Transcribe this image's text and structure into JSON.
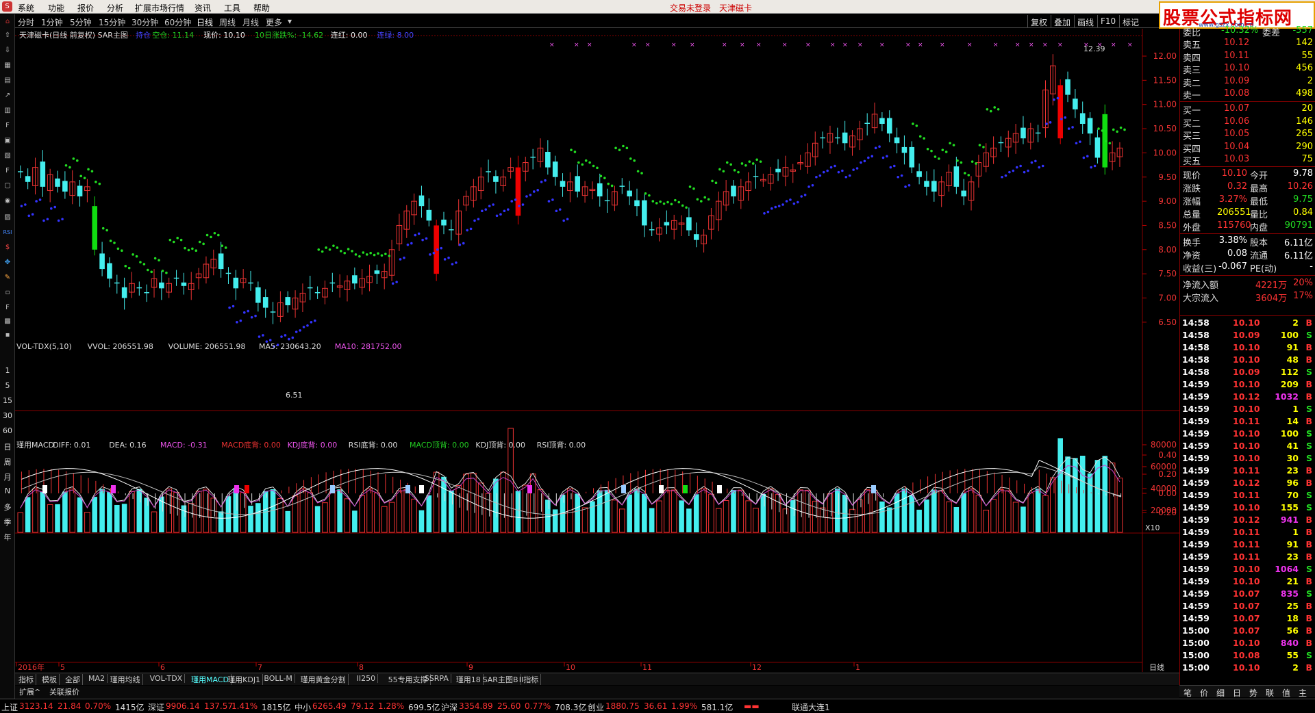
{
  "menu": {
    "items": [
      "系统",
      "功能",
      "报价",
      "分析",
      "扩展市场行情",
      "资讯",
      "工具",
      "帮助"
    ],
    "center_left": "交易未登录",
    "center_right": "天津磁卡"
  },
  "brand": {
    "title": "股票公式指标网",
    "sub": "www.gszx.com.cn"
  },
  "periods": [
    "分时",
    "1分钟",
    "5分钟",
    "15分钟",
    "30分钟",
    "60分钟",
    "日线",
    "周线",
    "月线",
    "更多"
  ],
  "active_period": "日线",
  "right_buttons": [
    "复权",
    "叠加",
    "画线",
    "F10",
    "标记"
  ],
  "left_tools": [
    "S",
    "F1",
    "F2",
    "F3",
    "F4",
    "F5",
    "F6",
    "F7",
    "F8",
    "F9",
    "F10",
    "RSI",
    "$",
    "F5",
    "F6",
    "F7"
  ],
  "left_numbers": [
    "1",
    "5",
    "15",
    "30",
    "60",
    "日",
    "周",
    "月",
    "N",
    "多",
    "季",
    "年"
  ],
  "main_header": {
    "stock": "天津磁卡(日线 前复权) SAR主图",
    "items": [
      {
        "t": "持仓",
        "c": "#44f"
      },
      {
        "t": "空仓: 11.14",
        "c": "#2c2"
      },
      {
        "t": "现价: 10.10",
        "c": "#eee"
      },
      {
        "t": "10日涨跌%: -14.62",
        "c": "#2c2"
      },
      {
        "t": "连红: 0.00",
        "c": "#eee"
      },
      {
        "t": "连绿: 8.00",
        "c": "#44f"
      }
    ]
  },
  "vol_header": {
    "items": [
      {
        "t": "VOL-TDX(5,10)",
        "c": "#ddd"
      },
      {
        "t": "VVOL: 206551.98",
        "c": "#ddd"
      },
      {
        "t": "VOLUME: 206551.98",
        "c": "#ddd"
      },
      {
        "t": "MA5: 230643.20",
        "c": "#ddd"
      },
      {
        "t": "MA10: 281752.00",
        "c": "#e5e"
      }
    ]
  },
  "macd_header": {
    "items": [
      {
        "t": "瑾用MACD",
        "c": "#ddd"
      },
      {
        "t": "DIFF: 0.01",
        "c": "#ddd"
      },
      {
        "t": "DEA: 0.16",
        "c": "#ddd"
      },
      {
        "t": "MACD: -0.31",
        "c": "#e5e"
      },
      {
        "t": "MACD底背: 0.00",
        "c": "#e33"
      },
      {
        "t": "KDJ底背: 0.00",
        "c": "#e5e"
      },
      {
        "t": "RSI底背: 0.00",
        "c": "#ddd"
      },
      {
        "t": "MACD顶背: 0.00",
        "c": "#2c2"
      },
      {
        "t": "KDJ顶背: 0.00",
        "c": "#ddd"
      },
      {
        "t": "RSI顶背: 0.00",
        "c": "#ddd"
      }
    ]
  },
  "price_axis": [
    "12.00",
    "11.50",
    "11.00",
    "10.50",
    "10.00",
    "9.50",
    "9.00",
    "8.50",
    "8.00",
    "7.50",
    "7.00",
    "6.50"
  ],
  "vol_axis": [
    "80000",
    "60000",
    "40000",
    "20000"
  ],
  "vol_unit": "X10",
  "macd_axis": [
    "0.40",
    "0.20",
    "0.00",
    "-0.20"
  ],
  "date_labels": [
    "2016年",
    "5",
    "6",
    "7",
    "8",
    "9",
    "10",
    "11",
    "12",
    "1"
  ],
  "date_right": "日线",
  "annotations": {
    "low": "6.51",
    "high": "12.39"
  },
  "chart_data": {
    "type": "candlestick",
    "title": "天津磁卡(日线 前复权) SAR主图",
    "high": 12.39,
    "low": 6.51,
    "last_close": 10.1,
    "ylim": [
      6.3,
      12.6
    ],
    "x_labels": [
      "2016年",
      "5",
      "6",
      "7",
      "8",
      "9",
      "10",
      "11",
      "12",
      "1"
    ]
  },
  "quote": {
    "top_partial": {
      "label": "委比",
      "value": "-10.32%",
      "label2": "委差",
      "value2": "-557"
    },
    "asks": [
      {
        "l": "卖五",
        "p": "10.12",
        "v": "142"
      },
      {
        "l": "卖四",
        "p": "10.11",
        "v": "55"
      },
      {
        "l": "卖三",
        "p": "10.10",
        "v": "456"
      },
      {
        "l": "卖二",
        "p": "10.09",
        "v": "2"
      },
      {
        "l": "卖一",
        "p": "10.08",
        "v": "498"
      }
    ],
    "bids": [
      {
        "l": "买一",
        "p": "10.07",
        "v": "20"
      },
      {
        "l": "买二",
        "p": "10.06",
        "v": "146"
      },
      {
        "l": "买三",
        "p": "10.05",
        "v": "265"
      },
      {
        "l": "买四",
        "p": "10.04",
        "v": "290"
      },
      {
        "l": "买五",
        "p": "10.03",
        "v": "75"
      }
    ],
    "stats": [
      {
        "l1": "现价",
        "v1": "10.10",
        "c1": "#f33",
        "l2": "今开",
        "v2": "9.78",
        "c2": "#fff"
      },
      {
        "l1": "涨跌",
        "v1": "0.32",
        "c1": "#f33",
        "l2": "最高",
        "v2": "10.26",
        "c2": "#f33"
      },
      {
        "l1": "涨幅",
        "v1": "3.27%",
        "c1": "#f33",
        "l2": "最低",
        "v2": "9.75",
        "c2": "#2d2"
      },
      {
        "l1": "总量",
        "v1": "206551",
        "c1": "#ff0",
        "l2": "量比",
        "v2": "0.84",
        "c2": "#ff0"
      },
      {
        "l1": "外盘",
        "v1": "115760",
        "c1": "#f33",
        "l2": "内盘",
        "v2": "90791",
        "c2": "#2d2"
      }
    ],
    "fund": [
      {
        "l1": "换手",
        "v1": "3.38%",
        "l2": "股本",
        "v2": "6.11亿"
      },
      {
        "l1": "净资",
        "v1": "0.08",
        "l2": "流通",
        "v2": "6.11亿"
      },
      {
        "l1": "收益(三)",
        "v1": "-0.067",
        "l2": "PE(动)",
        "v2": "-"
      }
    ],
    "flow": [
      {
        "l": "净流入额",
        "v": "4221万",
        "p": "20%"
      },
      {
        "l": "大宗流入",
        "v": "3604万",
        "p": "17%"
      }
    ]
  },
  "ticks": [
    [
      "14:58",
      "10.10",
      "2",
      "B"
    ],
    [
      "14:58",
      "10.09",
      "100",
      "S"
    ],
    [
      "14:58",
      "10.10",
      "91",
      "B"
    ],
    [
      "14:58",
      "10.10",
      "48",
      "B"
    ],
    [
      "14:58",
      "10.09",
      "112",
      "S"
    ],
    [
      "14:59",
      "10.10",
      "209",
      "B"
    ],
    [
      "14:59",
      "10.12",
      "1032",
      "B"
    ],
    [
      "14:59",
      "10.10",
      "1",
      "S"
    ],
    [
      "14:59",
      "10.11",
      "14",
      "B"
    ],
    [
      "14:59",
      "10.10",
      "100",
      "S"
    ],
    [
      "14:59",
      "10.10",
      "41",
      "S"
    ],
    [
      "14:59",
      "10.10",
      "30",
      "S"
    ],
    [
      "14:59",
      "10.11",
      "23",
      "B"
    ],
    [
      "14:59",
      "10.12",
      "96",
      "B"
    ],
    [
      "14:59",
      "10.11",
      "70",
      "S"
    ],
    [
      "14:59",
      "10.10",
      "155",
      "S"
    ],
    [
      "14:59",
      "10.12",
      "941",
      "B"
    ],
    [
      "14:59",
      "10.11",
      "1",
      "B"
    ],
    [
      "14:59",
      "10.11",
      "91",
      "B"
    ],
    [
      "14:59",
      "10.11",
      "23",
      "B"
    ],
    [
      "14:59",
      "10.10",
      "1064",
      "S"
    ],
    [
      "14:59",
      "10.10",
      "21",
      "B"
    ],
    [
      "14:59",
      "10.07",
      "835",
      "S"
    ],
    [
      "14:59",
      "10.07",
      "25",
      "B"
    ],
    [
      "14:59",
      "10.07",
      "18",
      "B"
    ],
    [
      "15:00",
      "10.07",
      "56",
      "B"
    ],
    [
      "15:00",
      "10.10",
      "840",
      "B"
    ],
    [
      "15:00",
      "10.08",
      "55",
      "S"
    ],
    [
      "15:00",
      "10.10",
      "2",
      "B"
    ]
  ],
  "tabs": [
    "指标",
    "模板",
    "全部",
    "MA2",
    "瑾用均线",
    "VOL-TDX",
    "瑾用MACD",
    "瑾用KDJ1",
    "BOLL-M",
    "瑾用黄金分割",
    "II250",
    "55专用支撑",
    "SSRPA",
    "瑾用18",
    "SAR主图B",
    "II指标"
  ],
  "active_tab": "瑾用MACD",
  "tabs2": [
    "扩展^",
    "关联报价"
  ],
  "right_tabs": [
    "笔",
    "价",
    "细",
    "日",
    "势",
    "联",
    "值",
    "主"
  ],
  "status": [
    {
      "name": "上证",
      "val": "3123.14",
      "chg": "21.84",
      "pct": "0.70%",
      "amt": "1415亿"
    },
    {
      "name": "深证",
      "val": "9906.14",
      "chg": "137.57",
      "pct": "1.41%",
      "amt": "1815亿"
    },
    {
      "name": "中小",
      "val": "6265.49",
      "chg": "79.12",
      "pct": "1.28%",
      "amt": "699.5亿"
    },
    {
      "name": "沪深",
      "val": "3354.89",
      "chg": "25.60",
      "pct": "0.77%",
      "amt": "708.3亿"
    },
    {
      "name": "创业",
      "val": "1880.75",
      "chg": "36.61",
      "pct": "1.99%",
      "amt": "581.1亿"
    }
  ],
  "status_right": "联通大连1"
}
